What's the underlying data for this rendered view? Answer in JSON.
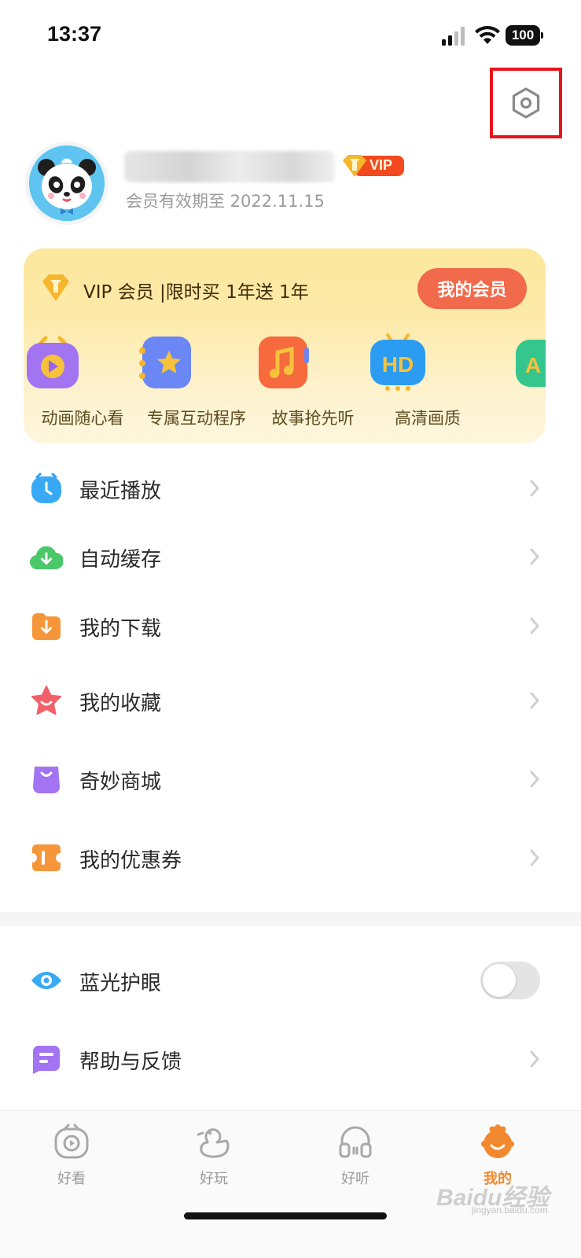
{
  "status_bar": {
    "time": "13:37",
    "battery": "100"
  },
  "profile": {
    "vip_label": "VIP",
    "expiry": "会员有效期至 2022.11.15"
  },
  "vip_card": {
    "promo": "VIP 会员 |限时买 1年送 1年",
    "button": "我的会员",
    "perks": [
      {
        "label": "动画随心看",
        "icon": "video-play-icon"
      },
      {
        "label": "专属互动程序",
        "icon": "star-app-icon"
      },
      {
        "label": "故事抢先听",
        "icon": "music-note-icon"
      },
      {
        "label": "高清画质",
        "icon": "hd-tv-icon"
      }
    ]
  },
  "menu": [
    {
      "label": "最近播放",
      "icon": "clock-icon"
    },
    {
      "label": "自动缓存",
      "icon": "cloud-download-icon"
    },
    {
      "label": "我的下载",
      "icon": "folder-download-icon"
    },
    {
      "label": "我的收藏",
      "icon": "star-icon"
    },
    {
      "label": "奇妙商城",
      "icon": "shopping-bag-icon"
    },
    {
      "label": "我的优惠券",
      "icon": "coupon-icon"
    }
  ],
  "settings_list": [
    {
      "label": "蓝光护眼",
      "icon": "eye-icon",
      "toggle": "off"
    },
    {
      "label": "帮助与反馈",
      "icon": "feedback-icon"
    }
  ],
  "tabs": [
    {
      "label": "好看",
      "icon": "tv-icon"
    },
    {
      "label": "好玩",
      "icon": "duck-icon"
    },
    {
      "label": "好听",
      "icon": "headphones-icon"
    },
    {
      "label": "我的",
      "icon": "profile-face-icon",
      "active": true
    }
  ],
  "watermark": {
    "main": "Baidu经验",
    "sub": "jingyan.baidu.com"
  },
  "colors": {
    "accent": "#f26a4c",
    "active_tab": "#f2892f",
    "highlight_box": "#e8141b"
  }
}
